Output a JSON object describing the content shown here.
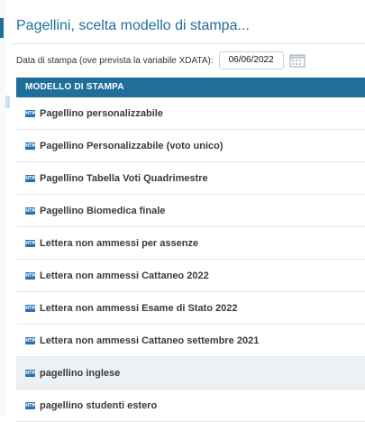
{
  "dialog": {
    "title": "Pagellini, scelta modello di stampa..."
  },
  "date_field": {
    "label": "Data di stampa (ove prevista la variabile XDATA):",
    "value": "06/06/2022"
  },
  "table": {
    "header": "MODELLO DI STAMPA",
    "icon_text": "HTM",
    "rows": [
      {
        "label": "Pagellino personalizzabile",
        "selected": false
      },
      {
        "label": "Pagellino Personalizzabile (voto unico)",
        "selected": false
      },
      {
        "label": "Pagellino Tabella Voti Quadrimestre",
        "selected": false
      },
      {
        "label": "Pagellino Biomedica finale",
        "selected": false
      },
      {
        "label": "Lettera non ammessi per assenze",
        "selected": false
      },
      {
        "label": "Lettera non ammessi Cattaneo 2022",
        "selected": false
      },
      {
        "label": "Lettera non ammessi Esame di Stato 2022",
        "selected": false
      },
      {
        "label": "Lettera non ammessi Cattaneo settembre 2021",
        "selected": false
      },
      {
        "label": "pagellino inglese",
        "selected": true
      },
      {
        "label": "pagellino studenti estero",
        "selected": false
      }
    ]
  },
  "colors": {
    "accent": "#1f6f9a",
    "icon_blue": "#2a6fb5",
    "selected_row": "#ecf1f4"
  }
}
